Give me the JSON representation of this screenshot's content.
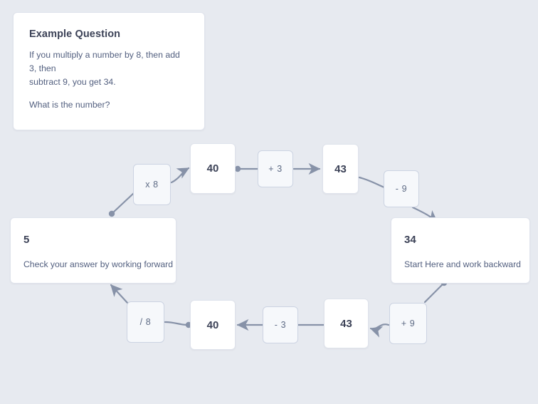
{
  "theme": {
    "background": "#e7eaf0",
    "card_background": "#ffffff",
    "card_border": "#dfe3ec",
    "operator_background": "#f6f8fb",
    "operator_border": "#ccd3e2",
    "title_text": "#3c4257",
    "body_text": "#525f7f",
    "connector": "#8792a8"
  },
  "question_card": {
    "title": "Example Question",
    "line1": "If you multiply a number by 8, then add 3, then",
    "line2": "subtract 9, you get 34.",
    "line3": "What is the number?"
  },
  "answer_card": {
    "value": "5",
    "label": "Check your answer by working forward"
  },
  "start_card": {
    "value": "34",
    "label": "Start Here and work backward"
  },
  "flow": {
    "forward_row": [
      {
        "id": "mul8",
        "type": "operator",
        "label": "x 8"
      },
      {
        "id": "40-top",
        "type": "value",
        "label": "40"
      },
      {
        "id": "plus3",
        "type": "operator",
        "label": "+ 3"
      },
      {
        "id": "43-top",
        "type": "value",
        "label": "43"
      },
      {
        "id": "minus9",
        "type": "operator",
        "label": "- 9"
      }
    ],
    "backward_row": [
      {
        "id": "plus9",
        "type": "operator",
        "label": "+ 9"
      },
      {
        "id": "43-bot",
        "type": "value",
        "label": "43"
      },
      {
        "id": "minus3",
        "type": "operator",
        "label": "- 3"
      },
      {
        "id": "40-bot",
        "type": "value",
        "label": "40"
      },
      {
        "id": "div8",
        "type": "operator",
        "label": "/ 8"
      }
    ]
  }
}
